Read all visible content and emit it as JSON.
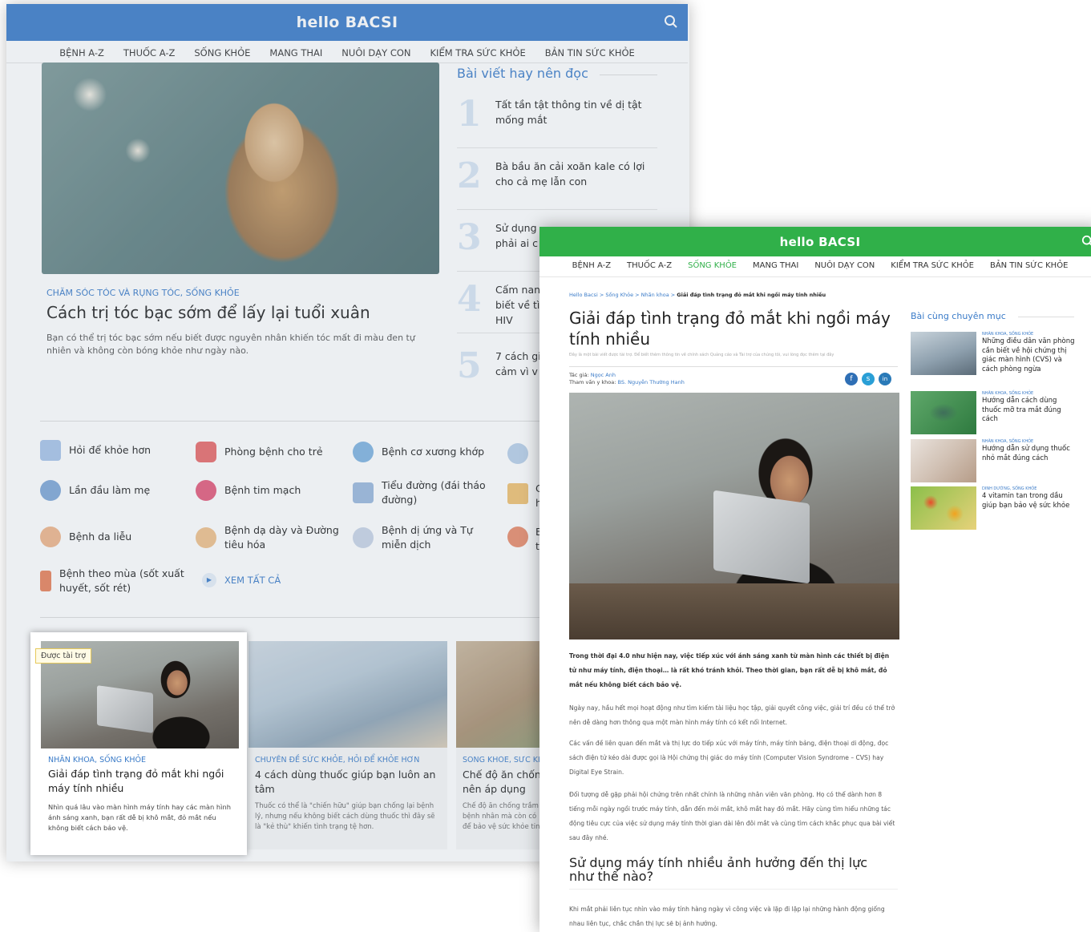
{
  "back": {
    "logo": "hello BACSI",
    "nav": [
      "BỆNH A-Z",
      "THUỐC A-Z",
      "SỐNG KHỎE",
      "MANG THAI",
      "NUÔI DẠY CON",
      "KIỂM TRA SỨC KHỎE",
      "BẢN TIN SỨC KHỎE"
    ],
    "hero": {
      "category": "CHĂM SÓC TÓC VÀ RỤNG TÓC, SỐNG KHỎE",
      "title": "Cách trị tóc bạc sớm để lấy lại tuổi xuân",
      "lead": "Bạn có thể trị tóc bạc sớm nếu biết được nguyên nhân khiến tóc mất đi màu đen tự nhiên và không còn bóng khỏe như ngày nào."
    },
    "recommended": {
      "title": "Bài viết hay nên đọc",
      "items": [
        {
          "num": "1",
          "title": "Tất tần tật thông tin về dị tật mống mắt"
        },
        {
          "num": "2",
          "title": "Bà bầu ăn cải xoăn kale có lợi cho cả mẹ lẫn con"
        },
        {
          "num": "3",
          "title": "Sử dụng phải ai c"
        },
        {
          "num": "4",
          "title": "Cấm nan biết về tì HIV"
        },
        {
          "num": "5",
          "title": "7 cách gi cảm vì v"
        }
      ]
    },
    "topics": [
      "Hỏi để khỏe hơn",
      "Phòng bệnh cho trẻ",
      "Bệnh cơ xương khớp",
      "Lần đầu làm mẹ",
      "Bệnh tim mạch",
      "Tiểu đường (đái tháo đường)",
      "Bệnh da liễu",
      "Bệnh dạ dày và Đường tiêu hóa",
      "Bệnh dị ứng và Tự miễn dịch",
      "Bệnh theo mùa (sốt xuất huyết, sốt rét)"
    ],
    "topic_partials": [
      "C",
      "h",
      "B",
      "t"
    ],
    "view_all": "XEM TẤT CẢ",
    "cards": [
      {
        "category": "CHUYÊN ĐỀ SỨC KHỎE, HỎI ĐỂ KHỎE HƠN",
        "title": "4 cách dùng thuốc giúp bạn luôn an tâm",
        "desc": "Thuốc có thể là \"chiến hữu\" giúp bạn chống lại bệnh lý, nhưng nếu không biết cách dùng thuốc thì đây sẽ là \"kẻ thù\" khiến tình trạng tệ hơn."
      },
      {
        "category": "SỐNG KHỎE, SỨC KH",
        "title": "Chế độ ăn chốn nên áp dụng",
        "desc": "Chế độ ăn chống trầm bệnh nhân mà còn có để bảo vệ sức khỏe tin"
      }
    ]
  },
  "sponsor": {
    "badge": "Được tài trợ",
    "category": "NHÃN KHOA, SỐNG KHỎE",
    "title": "Giải đáp tình trạng đỏ mắt khi ngồi máy tính nhiều",
    "desc": "Nhìn quá lâu vào màn hình máy tính hay các màn hình ánh sáng xanh, bạn rất dễ bị khô mắt, đỏ mắt nếu không biết cách bảo vệ."
  },
  "front": {
    "logo": "hello BACSI",
    "nav": [
      "BỆNH A-Z",
      "THUỐC A-Z",
      "SỐNG KHỎE",
      "MANG THAI",
      "NUÔI DẠY CON",
      "KIỂM TRA SỨC KHỎE",
      "BẢN TIN SỨC KHỎE"
    ],
    "breadcrumb": {
      "parts": "Hello Bacsi > Sống Khỏe > Nhãn khoa > ",
      "current": "Giải đáp tình trạng đỏ mắt khi ngồi máy tính nhiều"
    },
    "title": "Giải đáp tình trạng đỏ mắt khi ngồi máy tính nhiều",
    "disclaimer": "Đây là một bài viết được tài trợ. Để biết thêm thông tin về chính sách Quảng cáo và Tài trợ của chúng tôi, vui lòng đọc thêm tại đây",
    "author_label": "Tác giả: ",
    "author": "Ngọc Anh",
    "reviewer_label": "Tham vấn y khoa: ",
    "reviewer": "BS. Nguyễn Thường Hanh",
    "social": [
      "f",
      "s",
      "in"
    ],
    "intro": "Trong thời đại 4.0 như hiện nay, việc tiếp xúc với ánh sáng xanh từ màn hình các thiết bị điện tử như máy tính, điện thoại… là rất khó tránh khỏi. Theo thời gian, bạn rất dễ bị khô mắt, đỏ mắt nếu không biết cách bảo vệ.",
    "p1": "Ngày nay, hầu hết mọi hoạt động như tìm kiếm tài liệu học tập, giải quyết công việc, giải trí đều có thể trở nên dễ dàng hơn thông qua một màn hình máy tính có kết nối Internet.",
    "p2": "Các vấn đề liên quan đến mắt và thị lực do tiếp xúc với máy tính, máy tính bảng, điện thoại di động, đọc sách điện tử kéo dài được gọi là Hội chứng thị giác do máy tính (Computer Vision Syndrome – CVS) hay Digital Eye Strain.",
    "p3": "Đối tượng dễ gặp phải hội chứng trên nhất chính là những nhân viên văn phòng. Họ có thể dành hơn 8 tiếng mỗi ngày ngồi trước máy tính, dẫn đến mỏi mắt, khô mắt hay đỏ mắt. Hãy cùng tìm hiểu những tác động tiêu cực của việc sử dụng máy tính thời gian dài lên đôi mắt và cùng tìm cách khắc phục qua bài viết sau đây nhé.",
    "h2": "Sử dụng máy tính nhiều ảnh hưởng đến thị lực như thế nào?",
    "p4": "Khi mắt phải liên tục nhìn vào máy tính hàng ngày vì công việc và lặp đi lặp lại những hành động giống nhau liên tục, chắc chắn thị lực sẽ bị ảnh hưởng.",
    "sidebar": {
      "title": "Bài cùng chuyên mục",
      "items": [
        {
          "category": "NHÃN KHOA, SỐNG KHỎE",
          "title": "Những điều dân văn phòng cần biết về hội chứng thị giác màn hình (CVS) và cách phòng ngừa"
        },
        {
          "category": "NHÃN KHOA, SỐNG KHỎE",
          "title": "Hướng dẫn cách dùng thuốc mỡ tra mắt đúng cách"
        },
        {
          "category": "NHÃN KHOA, SỐNG KHỎE",
          "title": "Hướng dẫn sử dụng thuốc nhỏ mắt đúng cách"
        },
        {
          "category": "DINH DƯỠNG, SỐNG KHỎE",
          "title": "4 vitamin tan trong dầu giúp bạn bảo vệ sức khỏe"
        }
      ]
    }
  },
  "colors": {
    "back_header": "#3a7bc8",
    "front_header": "#30b049",
    "link": "#3a7bc8"
  }
}
